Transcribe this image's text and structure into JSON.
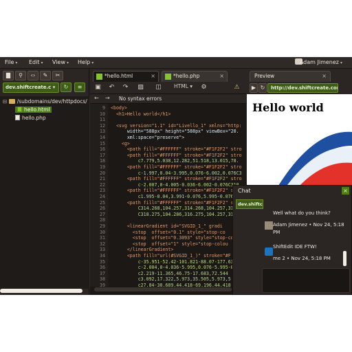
{
  "menubar": {
    "items": [
      {
        "label": "File"
      },
      {
        "label": "Edit"
      },
      {
        "label": "View"
      },
      {
        "label": "Help"
      }
    ],
    "user_name": "Adam Jimenez"
  },
  "sidebar": {
    "site_select": "dev.shiftcreate.c",
    "tree": [
      {
        "label": "/subdomains/dev/httpdocs/",
        "type": "folder"
      },
      {
        "label": "hello.html",
        "type": "file",
        "selected": true
      },
      {
        "label": "hello.php",
        "type": "file",
        "selected": false
      }
    ]
  },
  "editor": {
    "tabs": [
      {
        "label": "*hello.html"
      },
      {
        "label": "*hello.php"
      }
    ],
    "mode": "HTML",
    "status": "No syntax errors",
    "lines": [
      {
        "n": "9",
        "text": "<body>"
      },
      {
        "n": "10",
        "text": "  <h1>Hello world</h1>"
      },
      {
        "n": "11",
        "text": ""
      },
      {
        "n": "12",
        "text": "  <svg version=\"1.1\" id=\"Livello_1\" xmlns=\"http:"
      },
      {
        "n": "13",
        "text": "      width=\"588px\" height=\"588px\" viewBox=\"20."
      },
      {
        "n": "14",
        "text": "      xml:space=\"preserve\">"
      },
      {
        "n": "15",
        "text": "    <g>"
      },
      {
        "n": "16",
        "text": "      <path fill=\"#FFFFFF\" stroke=\"#F1F2F2\" stro"
      },
      {
        "n": "17",
        "text": "      <path fill=\"#FFFFFF\" stroke=\"#F1F2F2\" stro"
      },
      {
        "n": "18",
        "text": "          c7.779,5.038,12.282,51.518,13.015,78."
      },
      {
        "n": "19",
        "text": "      <path fill=\"#FFFFFF\" stroke=\"#F1F2F2\" stro"
      },
      {
        "n": "20",
        "text": "          c-1.997,0.04-3.995,0.076-6.002,0.076C3"
      },
      {
        "n": "21",
        "text": "      <path fill=\"#FFFFFF\" stroke=\"#F1F2F2\" stro"
      },
      {
        "n": "22",
        "text": "          c-2.007,0-4.005-0.036-6.002-0.076C310."
      },
      {
        "n": "23",
        "text": "      <path fill=\"#FFFFFF\" stroke=\"#F1F2F2\" stro"
      },
      {
        "n": "24",
        "text": "          c1.995-0.04,3.991-0.076,5.995-0.076"
      },
      {
        "n": "25",
        "text": "      <path fill=\"#FFFFFF\" stroke=\"#F1F2F2\" stro"
      },
      {
        "n": "26",
        "text": "          C314.268,104.257,314.268,104.257,31"
      },
      {
        "n": "27",
        "text": "          C318.275,104.286,316.275,104.257,31"
      },
      {
        "n": "28",
        "text": ""
      },
      {
        "n": "29",
        "text": "      <linearGradient id=\"SVGID_1_\" gradi"
      },
      {
        "n": "30",
        "text": "        <stop  offset=\"0.1\" style=\"stop-co"
      },
      {
        "n": "31",
        "text": "        <stop  offset=\"0.3093\" style=\"stop-co"
      },
      {
        "n": "32",
        "text": "        <stop  offset=\"1\" style=\"stop-colou"
      },
      {
        "n": "33",
        "text": "      </linearGradient>"
      },
      {
        "n": "34",
        "text": "      <path fill=\"url(#SVGID_1_)\" stroke=\"#F"
      },
      {
        "n": "35",
        "text": "          c-35.951-52.42-101.821-88.07-177.63"
      },
      {
        "n": "36",
        "text": "          c-2.004,0-4.036-5.995,0.076-5.995-0.0"
      },
      {
        "n": "37",
        "text": "          c2.219-11.365,46.75-17.683,72.544"
      },
      {
        "n": "38",
        "text": "          c3.092,17.322,5.973,35.505,5.973,5"
      },
      {
        "n": "39",
        "text": "          c27.84-30.689,44.418-69.196,44.418"
      }
    ]
  },
  "preview": {
    "tab": "Preview",
    "url": "http://dev.shiftcreate.com",
    "heading": "Hello world"
  },
  "chat": {
    "title": "Chat",
    "site": "dev.shiftcre",
    "messages": [
      {
        "text": "Well what do you think?",
        "meta": "Adam Jimenez • Nov 24, 5:18",
        "meta2": "PM"
      },
      {
        "text": "ShiftEdit IDE FTW!",
        "meta": "me 2 • Nov 24, 5:18 PM"
      }
    ]
  },
  "colors": {
    "accent_green": "#4f7d16",
    "background": "#2b2623"
  }
}
